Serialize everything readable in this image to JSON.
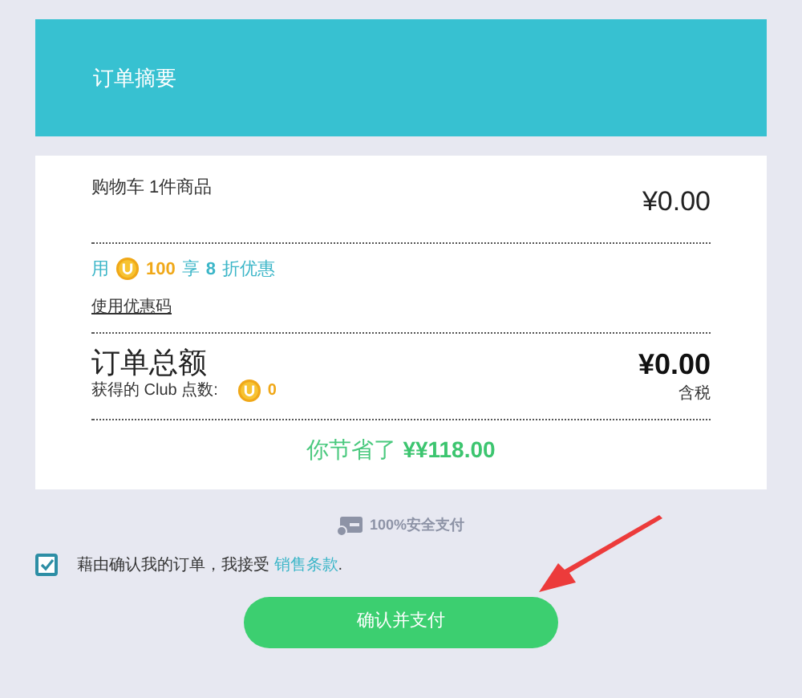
{
  "header": {
    "title": "订单摘要"
  },
  "cart": {
    "label": "购物车 1件商品",
    "price": "¥0.00"
  },
  "offer": {
    "prefix": "用",
    "coins": "100",
    "middle": "享",
    "discount": "8",
    "suffix": "折优惠"
  },
  "promo_link": "使用优惠码",
  "total": {
    "label": "订单总额",
    "points_label": "获得的 Club 点数:",
    "points": "0",
    "price": "¥0.00",
    "tax_note": "含税"
  },
  "savings": {
    "prefix": "你节省了",
    "amount": "¥¥118.00"
  },
  "secure": "100%安全支付",
  "terms": {
    "checked": true,
    "text": "藉由确认我的订单，我接受",
    "link": "销售条款",
    "end": "."
  },
  "confirm_button": "确认并支付"
}
